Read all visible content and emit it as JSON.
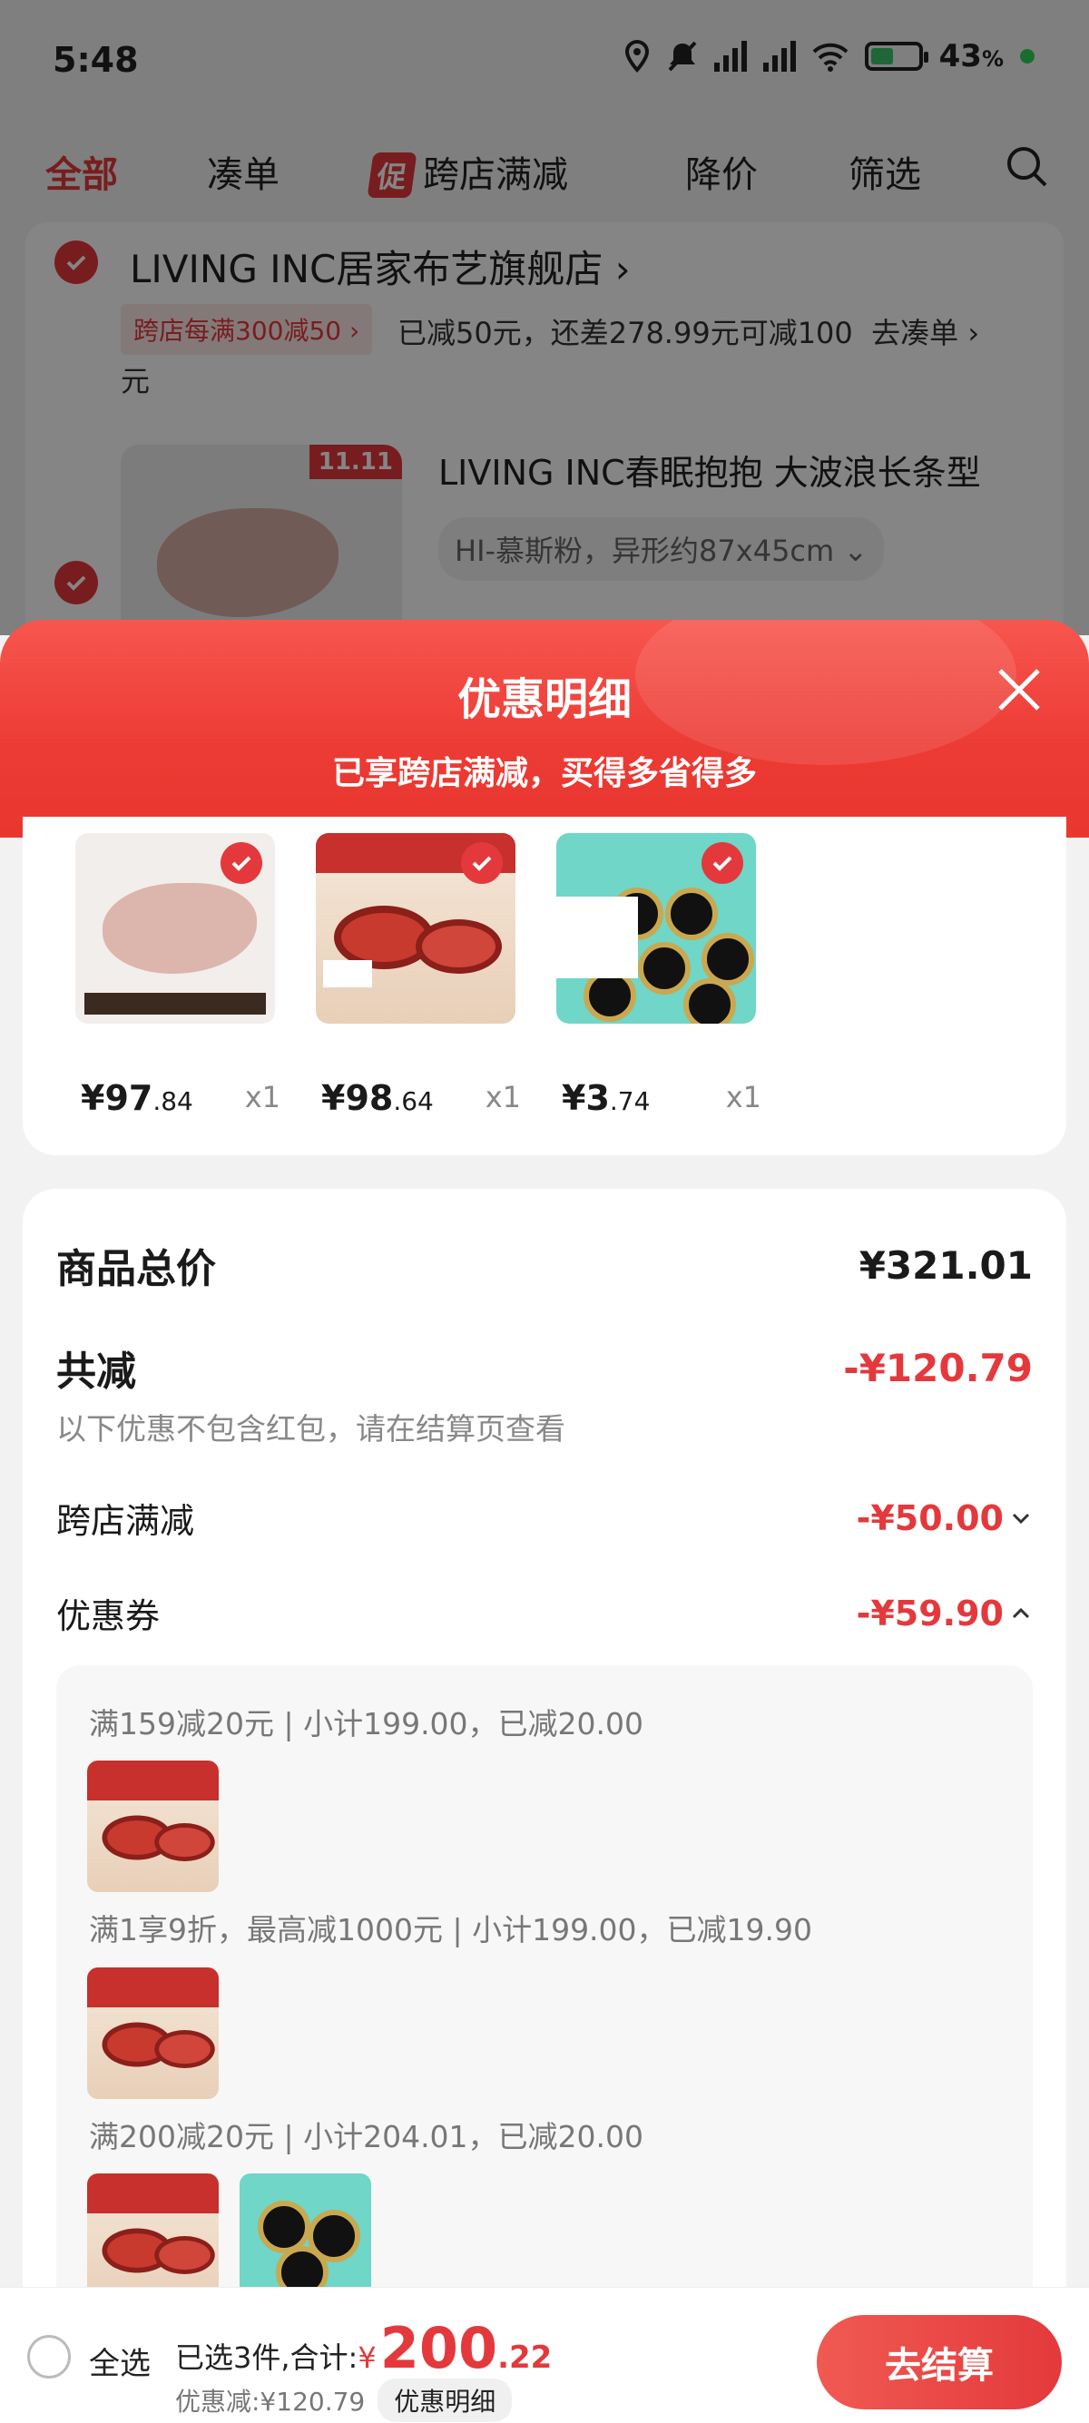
{
  "status_bar": {
    "time": "5:48",
    "battery": "43",
    "battery_unit": "%"
  },
  "tabs": [
    {
      "label": "全部"
    },
    {
      "label": "凑单"
    },
    {
      "label": "跨店满减",
      "badge": "促"
    },
    {
      "label": "降价"
    },
    {
      "label": "筛选"
    }
  ],
  "store": {
    "name": "LIVING INC居家布艺旗舰店",
    "promo_tag": "跨店每满300减50",
    "promo_text": "已减50元，还差278.99元可减100",
    "promo_text_end": "元",
    "go_bundle": "去凑单",
    "item": {
      "title": "LIVING INC春眠抱抱 大波浪长条型",
      "spec": "HI-慕斯粉，异形约87x45cm",
      "badge": "11.11"
    }
  },
  "sheet": {
    "title": "优惠明细",
    "subtitle": "已享跨店满减，买得多省得多"
  },
  "products": [
    {
      "price_int": "¥97",
      "price_dec": ".84",
      "qty": "x1"
    },
    {
      "price_int": "¥98",
      "price_dec": ".64",
      "qty": "x1"
    },
    {
      "price_int": "¥3",
      "price_dec": ".74",
      "qty": "x1"
    }
  ],
  "summary": {
    "total_label": "商品总价",
    "total_value": "¥321.01",
    "reduce_label": "共减",
    "reduce_value": "-¥120.79",
    "note": "以下优惠不包含红包，请在结算页查看",
    "cross_store_label": "跨店满减",
    "cross_store_value": "-¥50.00",
    "coupon_label": "优惠券",
    "coupon_value": "-¥59.90"
  },
  "coupons": [
    {
      "text": "满159减20元 | 小计199.00，已减20.00"
    },
    {
      "text": "满1享9折，最高减1000元 | 小计199.00，已减19.90"
    },
    {
      "text": "满200减20元 | 小计204.01，已减20.00"
    }
  ],
  "bottom_bar": {
    "select_all": "全选",
    "selected_text": "已选3件,合计:",
    "currency": "¥",
    "amount_int": "200",
    "amount_dec": ".22",
    "discount_text": "优惠减:¥120.79",
    "detail_button": "优惠明细",
    "checkout_button": "去结算"
  },
  "colors": {
    "accent": "#e4393c",
    "sheet_header": "#ec3a34"
  }
}
